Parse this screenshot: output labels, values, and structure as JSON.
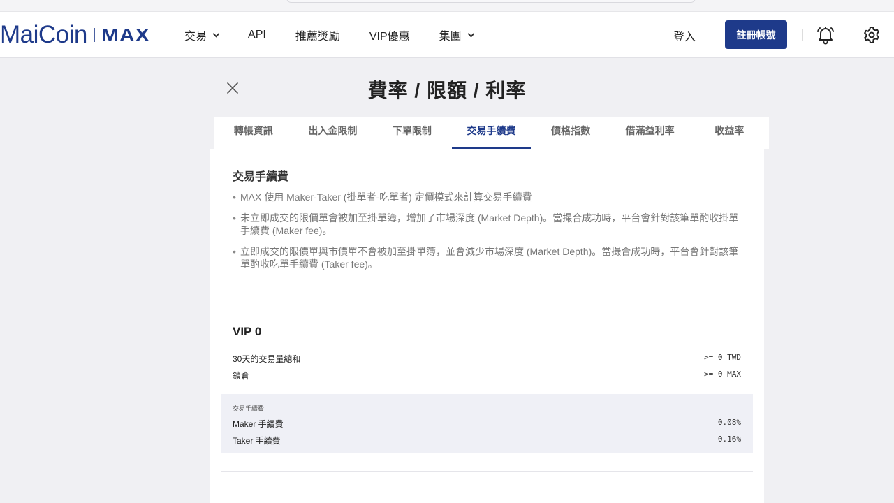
{
  "header": {
    "logo_left": "MaiCoin",
    "logo_right": "MAX",
    "nav": [
      {
        "label": "交易",
        "dropdown": true
      },
      {
        "label": "API",
        "dropdown": false
      },
      {
        "label": "推薦獎勵",
        "dropdown": false
      },
      {
        "label": "VIP優惠",
        "dropdown": false
      },
      {
        "label": "集團",
        "dropdown": true
      }
    ],
    "login_label": "登入",
    "register_label": "註冊帳號",
    "icons": [
      "bell-icon",
      "gear-icon"
    ]
  },
  "page": {
    "title": "費率 / 限額 / 利率",
    "close_icon": "close-icon"
  },
  "tabs": [
    {
      "label": "轉帳資訊",
      "active": false
    },
    {
      "label": "出入金限制",
      "active": false
    },
    {
      "label": "下單限制",
      "active": false
    },
    {
      "label": "交易手續費",
      "active": true
    },
    {
      "label": "價格指數",
      "active": false
    },
    {
      "label": "借滿益利率",
      "active": false
    },
    {
      "label": "收益率",
      "active": false
    }
  ],
  "content": {
    "section_title": "交易手續費",
    "bullets": [
      "MAX 使用 Maker-Taker (掛單者-吃單者) 定價模式來計算交易手續費",
      "未立即成交的限價單會被加至掛單簿，增加了市場深度 (Market Depth)。當撮合成功時，平台會針對該筆單酌收掛單手續費 (Maker fee)。",
      "立即成交的限價單與市價單不會被加至掛單簿，並會減少市場深度 (Market Depth)。當撮合成功時，平台會針對該筆單酌收吃單手續費 (Taker fee)。"
    ],
    "vip": {
      "title": "VIP 0",
      "requirements": [
        {
          "label": "30天的交易量總和",
          "value": ">= 0 TWD"
        },
        {
          "label": "鎖倉",
          "value": ">= 0 MAX"
        }
      ],
      "fees_header": "交易手續費",
      "fees": [
        {
          "label": "Maker 手續費",
          "value": "0.08%"
        },
        {
          "label": "Taker 手續費",
          "value": "0.16%"
        }
      ]
    }
  },
  "colors": {
    "brand": "#1e3a8a",
    "background": "#f0f0f3",
    "fee_box": "#eff0f6"
  }
}
